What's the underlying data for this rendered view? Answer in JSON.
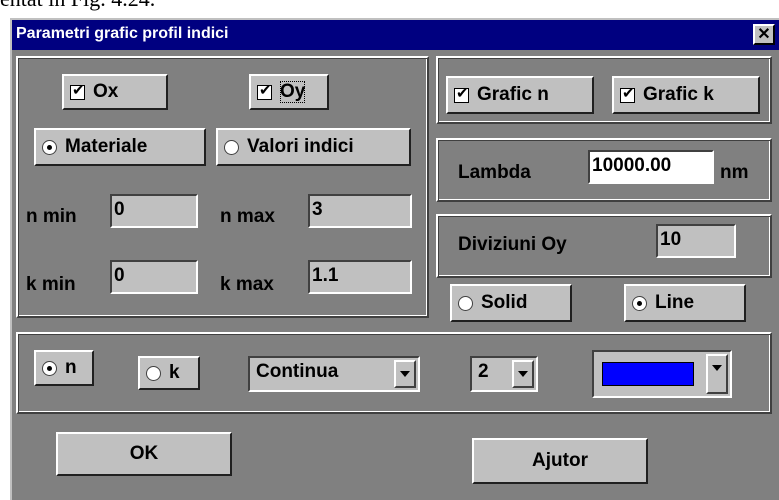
{
  "doc_caption": "entat în Fig. 4.24.",
  "dialog": {
    "title": "Parametri grafic profil indici",
    "close_glyph": "✕"
  },
  "axes": {
    "ox": {
      "label": "Ox",
      "checked": true
    },
    "oy": {
      "label": "Oy",
      "checked": true
    }
  },
  "source": {
    "materiale": {
      "label": "Materiale",
      "selected": true
    },
    "valori": {
      "label": "Valori indici",
      "selected": false
    }
  },
  "limits": {
    "n_min_label": "n min",
    "n_min": "0",
    "n_max_label": "n max",
    "n_max": "3",
    "k_min_label": "k min",
    "k_min": "0",
    "k_max_label": "k max",
    "k_max": "1.1"
  },
  "graphs": {
    "grafic_n": {
      "label": "Grafic n",
      "checked": true
    },
    "grafic_k": {
      "label": "Grafic k",
      "checked": true
    }
  },
  "lambda": {
    "label": "Lambda",
    "value": "10000.00",
    "unit": "nm"
  },
  "diviziuni": {
    "label": "Diviziuni Oy",
    "value": "10"
  },
  "style": {
    "solid": {
      "label": "Solid",
      "selected": false
    },
    "line": {
      "label": "Line",
      "selected": true
    }
  },
  "bottom": {
    "n_label": "n",
    "n_selected": true,
    "k_label": "k",
    "k_selected": false,
    "line_type": "Continua",
    "width": "2",
    "color": "#0000ff"
  },
  "buttons": {
    "ok": "OK",
    "help": "Ajutor"
  },
  "colors": {
    "titlebar": "#000080",
    "face": "#c0c0c0",
    "dialog_bg": "#808080"
  },
  "icons": {
    "checkbox": "checkmark",
    "radio": "radio-dot",
    "dropdown": "chevron-down-icon"
  }
}
